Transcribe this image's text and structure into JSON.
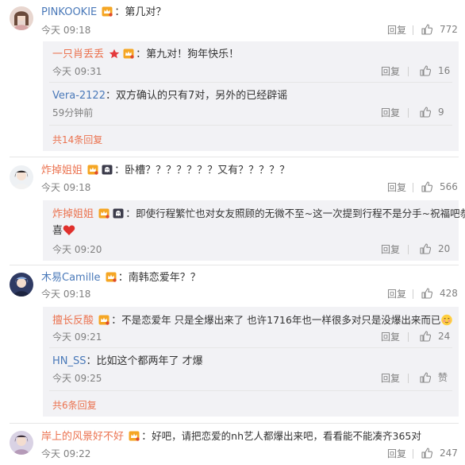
{
  "comments": [
    {
      "user": "PINKOOKIE",
      "separator": "：",
      "text": "第几对？",
      "time": "今天 09:18",
      "reply_label": "回复",
      "likes": "772",
      "replies": [
        {
          "user": "一只肖丢丢",
          "separator": "：",
          "text": "第九对！狗年快乐！",
          "time": "今天 09:31",
          "reply_label": "回复",
          "likes": "16"
        },
        {
          "user": "Vera-2122",
          "separator": "：",
          "text": "双方确认的只有7对，另外的已经辟谣",
          "time": "59分钟前",
          "reply_label": "回复",
          "likes": "9"
        }
      ],
      "more_replies": "共14条回复"
    },
    {
      "user": "炸掉姐姐",
      "separator": "：",
      "text": "卧槽？？？？？？？又有？？？？？",
      "time": "今天 09:18",
      "reply_label": "回复",
      "likes": "566",
      "replies": [
        {
          "user": "炸掉姐姐",
          "separator": "：",
          "text_line1": "即使行程繁忙也对女友照顾的无微不至~这一次提到行程不是分手~祝福吧恭",
          "text_line2": "喜",
          "time": "今天 09:20",
          "reply_label": "回复",
          "likes": "20"
        }
      ]
    },
    {
      "user": "木易Camille",
      "separator": "：",
      "text": "南韩恋爱年？？",
      "time": "今天 09:18",
      "reply_label": "回复",
      "likes": "428",
      "replies": [
        {
          "user": "擅长反酸",
          "separator": "：",
          "text": "不是恋爱年 只是全爆出来了 也许1716年也一样很多对只是没爆出来而已",
          "time": "今天 09:21",
          "reply_label": "回复",
          "likes": "24"
        },
        {
          "user": "HN_SS",
          "separator": "：",
          "text": "比如这个都两年了 才爆",
          "time": "今天 09:25",
          "reply_label": "回复",
          "likes": "赞"
        }
      ],
      "more_replies": "共6条回复"
    },
    {
      "user": "岸上的风景好不好",
      "separator": "：",
      "text": "好吧，请把恋爱的nh艺人都爆出来吧，看看能不能凑齐365对",
      "time": "今天 09:22",
      "reply_label": "回复",
      "likes": "247"
    }
  ],
  "colors": {
    "username": "#eb7350",
    "link_blue": "#4a79b9",
    "meta": "#808080",
    "reply_bg": "#f2f2f5"
  },
  "icons": [
    "avatar",
    "vip-crown-badge",
    "star-badge",
    "ghost-badge",
    "like-thumb-icon",
    "heart-emoji",
    "blush-emoji"
  ]
}
